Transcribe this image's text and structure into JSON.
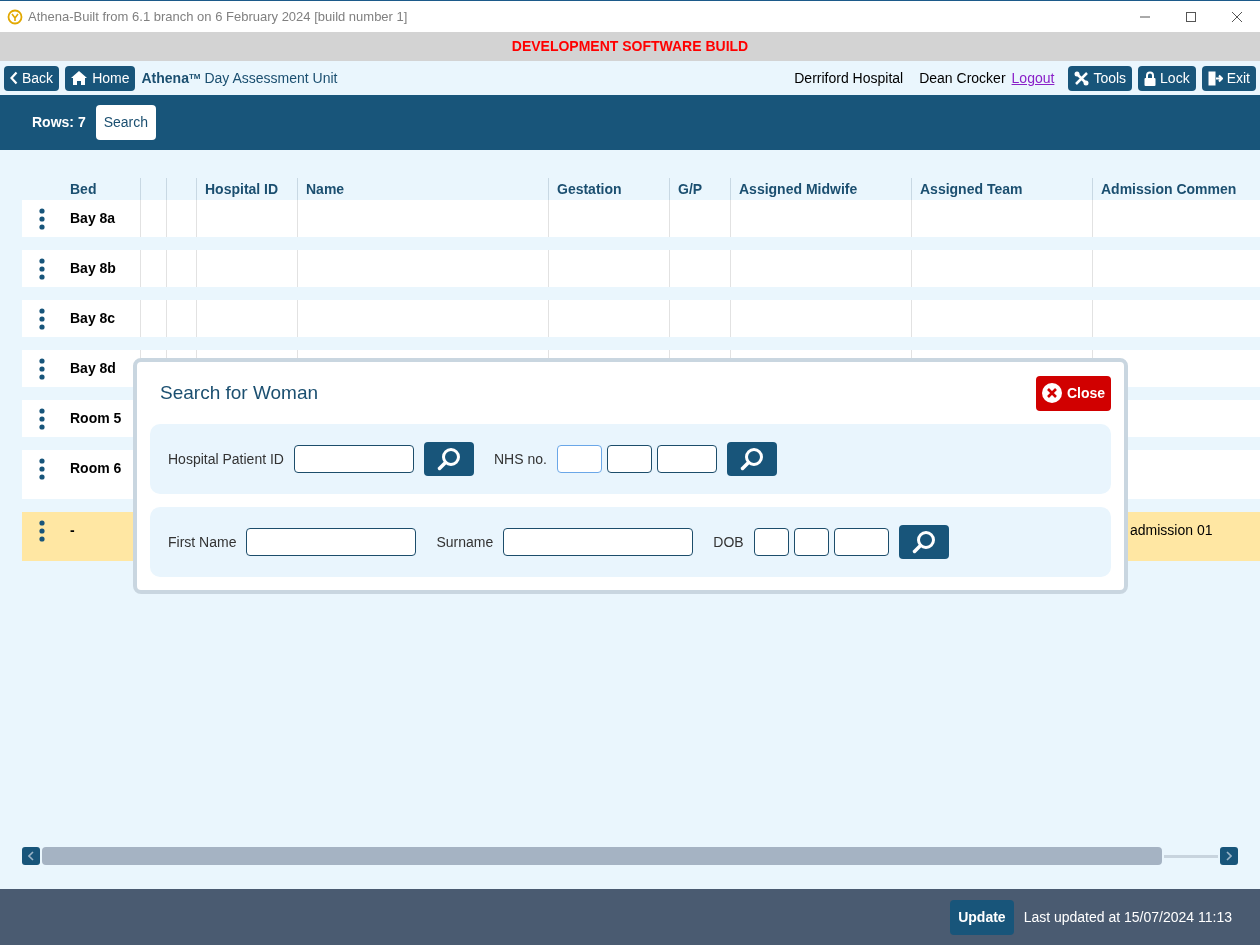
{
  "window": {
    "title": "Athena-Built from 6.1 branch on 6 February 2024 [build number 1]"
  },
  "banner": "DEVELOPMENT SOFTWARE BUILD",
  "nav": {
    "back": "Back",
    "home": "Home",
    "brand": "Athena",
    "brand_mark": "TM",
    "unit": "Day Assessment Unit",
    "hospital": "Derriford Hospital",
    "user": "Dean Crocker",
    "logout": "Logout",
    "tools": "Tools",
    "lock": "Lock",
    "exit": "Exit"
  },
  "toolbar": {
    "rows": "Rows: 7",
    "search": "Search"
  },
  "table": {
    "columns": [
      "Bed",
      "Hospital ID",
      "Name",
      "Gestation",
      "G/P",
      "Assigned Midwife",
      "Assigned Team",
      "Admission Commen"
    ],
    "rows": [
      {
        "bed": "Bay 8a",
        "highlighted": false
      },
      {
        "bed": "Bay 8b",
        "highlighted": false
      },
      {
        "bed": "Bay 8c",
        "highlighted": false
      },
      {
        "bed": "Bay 8d",
        "highlighted": false
      },
      {
        "bed": "Room 5",
        "highlighted": false
      },
      {
        "bed": "Room 6",
        "highlighted": false
      },
      {
        "bed": "-",
        "highlighted": true,
        "admission_comment": "admission 01"
      }
    ]
  },
  "dialog": {
    "title": "Search for Woman",
    "close": "Close",
    "hospital_id_label": "Hospital Patient ID",
    "nhs_label": "NHS no.",
    "nhs_fields": [
      {
        "focused": true
      },
      {
        "focused": false
      },
      {
        "focused": false
      }
    ],
    "first_name_label": "First Name",
    "surname_label": "Surname",
    "dob_label": "DOB"
  },
  "footer": {
    "update": "Update",
    "last_updated": "Last updated at 15/07/2024 11:13"
  }
}
